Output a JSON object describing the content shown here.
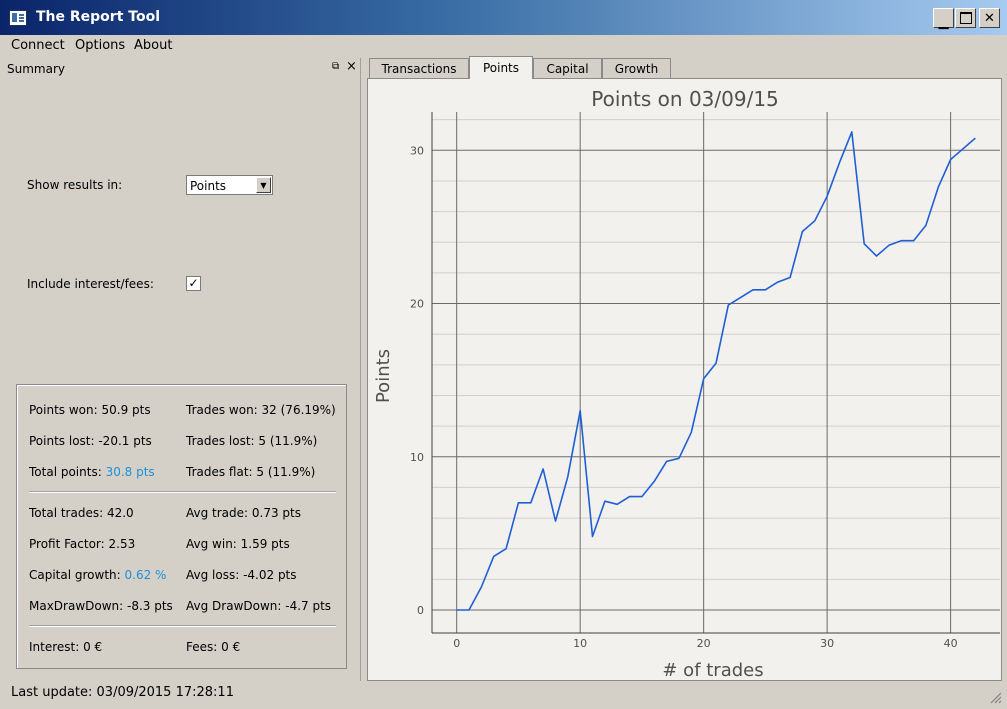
{
  "window": {
    "title": "The Report Tool"
  },
  "menu": [
    "Connect",
    "Options",
    "About"
  ],
  "dock": {
    "title": "Summary"
  },
  "options": {
    "show_results_label": "Show results in:",
    "show_results_value": "Points",
    "include_fees_label": "Include interest/fees:",
    "include_fees_checked": true
  },
  "stats": {
    "points_won": "Points won: 50.9 pts",
    "trades_won": "Trades won: 32 (76.19%)",
    "points_lost": "Points lost: -20.1 pts",
    "trades_lost": "Trades lost: 5 (11.9%)",
    "total_points_label": "Total points: ",
    "total_points_value": "30.8 pts",
    "trades_flat": "Trades flat: 5 (11.9%)",
    "total_trades": "Total trades: 42.0",
    "avg_trade": "Avg trade: 0.73 pts",
    "profit_factor": "Profit Factor: 2.53",
    "avg_win": "Avg win: 1.59 pts",
    "capital_growth_label": "Capital growth: ",
    "capital_growth_value": "0.62 %",
    "avg_loss": "Avg loss: -4.02 pts",
    "max_drawdown": "MaxDrawDown: -8.3 pts",
    "avg_drawdown": "Avg DrawDown: -4.7 pts",
    "interest": "Interest: 0 €",
    "fees": "Fees: 0 €"
  },
  "tabs": [
    "Transactions",
    "Points",
    "Capital",
    "Growth"
  ],
  "status": "Last update: 03/09/2015 17:28:11",
  "colors": {
    "highlight": "#1e90d8",
    "line": "#1f5fd6",
    "title_start": "#0a246a",
    "title_end": "#a6caf0"
  },
  "chart_data": {
    "type": "line",
    "title": "Points on 03/09/15",
    "xlabel": "# of trades",
    "ylabel": "Points",
    "xlim": [
      -2,
      44
    ],
    "ylim": [
      -1.5,
      32.5
    ],
    "xticks": [
      0,
      10,
      20,
      30,
      40
    ],
    "yticks": [
      0,
      10,
      20,
      30
    ],
    "grid": true,
    "x": [
      0,
      1,
      2,
      3,
      4,
      5,
      6,
      7,
      8,
      9,
      10,
      11,
      12,
      13,
      14,
      15,
      16,
      17,
      18,
      19,
      20,
      21,
      22,
      23,
      24,
      25,
      26,
      27,
      28,
      29,
      30,
      31,
      32,
      33,
      34,
      35,
      36,
      37,
      38,
      39,
      40,
      41,
      42
    ],
    "values": [
      0,
      0,
      1.5,
      3.5,
      4,
      7,
      7,
      9.2,
      5.8,
      8.7,
      13,
      4.8,
      7.1,
      6.9,
      7.4,
      7.4,
      8.4,
      9.7,
      9.9,
      11.6,
      15.1,
      16.1,
      19.9,
      20.4,
      20.9,
      20.9,
      21.4,
      21.7,
      24.7,
      25.4,
      27,
      29.2,
      31.2,
      23.9,
      23.1,
      23.8,
      24.1,
      24.1,
      25.1,
      27.6,
      29.4,
      30.1,
      30.8
    ]
  }
}
